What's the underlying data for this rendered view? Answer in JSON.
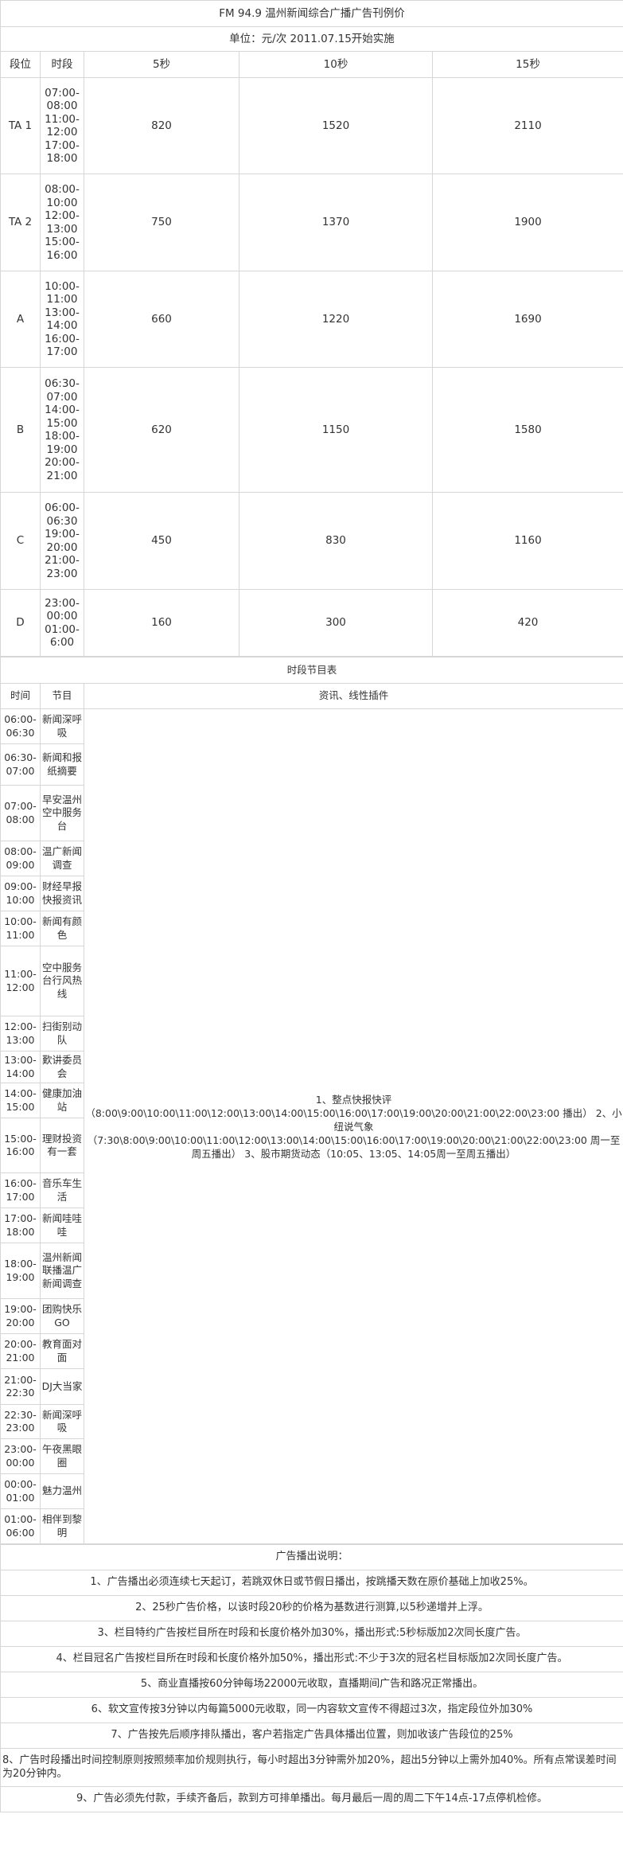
{
  "title": "FM 94.9 温州新闻综合广播广告刊例价",
  "subtitle": "单位：元/次  2011.07.15开始实施",
  "rate_headers": [
    "段位",
    "时段",
    "5秒",
    "10秒",
    "15秒"
  ],
  "rate_rows": [
    {
      "tier": "TA 1",
      "slots": "07:00-\n08:00\n11:00-\n12:00\n17:00-\n18:00",
      "p5": "820",
      "p10": "1520",
      "p15": "2110"
    },
    {
      "tier": "TA 2",
      "slots": "08:00-\n10:00\n12:00-\n13:00\n15:00-\n16:00",
      "p5": "750",
      "p10": "1370",
      "p15": "1900"
    },
    {
      "tier": "A",
      "slots": "10:00-\n11:00\n13:00-\n14:00\n16:00-\n17:00",
      "p5": "660",
      "p10": "1220",
      "p15": "1690"
    },
    {
      "tier": "B",
      "slots": "06:30-\n07:00\n14:00-\n15:00\n18:00-\n19:00\n20:00-\n21:00",
      "p5": "620",
      "p10": "1150",
      "p15": "1580"
    },
    {
      "tier": "C",
      "slots": "06:00-\n06:30\n19:00-\n20:00\n21:00-\n23:00",
      "p5": "450",
      "p10": "830",
      "p15": "1160"
    },
    {
      "tier": "D",
      "slots": "23:00-\n00:00\n01:00-\n6:00",
      "p5": "160",
      "p10": "300",
      "p15": "420"
    }
  ],
  "schedule_title": "时段节目表",
  "schedule_headers": [
    "时间",
    "节目",
    "资讯、线性插件"
  ],
  "schedule_info": "1、整点快报快评\n（8:00\\9:00\\10:00\\11:00\\12:00\\13:00\\14:00\\15:00\\16:00\\17:00\\19:00\\20:00\\21:00\\22:00\\23:00  播出） 2、小纽说气象\n（7:30\\8:00\\9:00\\10:00\\11:00\\12:00\\13:00\\14:00\\15:00\\16:00\\17:00\\19:00\\20:00\\21:00\\22:00\\23:00 周一至周五播出） 3、股市期货动态（10:05、13:05、14:05周一至周五播出）",
  "schedule_rows": [
    {
      "time": "06:00-\n06:30",
      "program": "新闻深呼吸"
    },
    {
      "time": "06:30-\n07:00",
      "program": "新闻和报纸摘要"
    },
    {
      "time": "07:00-\n08:00",
      "program": "早安温州 空中服务台"
    },
    {
      "time": "08:00-\n09:00",
      "program": "温广新闻调查"
    },
    {
      "time": "09:00-\n10:00",
      "program": "财经早报 快报资讯"
    },
    {
      "time": "10:00-\n11:00",
      "program": "新闻有颜色"
    },
    {
      "time": "11:00-\n12:00",
      "program": "空中服务台行风热线"
    },
    {
      "time": "12:00-\n13:00",
      "program": "扫街别动队"
    },
    {
      "time": "13:00-\n14:00",
      "program": "歎讲委员会"
    },
    {
      "time": "14:00-\n15:00",
      "program": "健康加油站"
    },
    {
      "time": "15:00-\n16:00",
      "program": "理财投资有一套"
    },
    {
      "time": "16:00-\n17:00",
      "program": "音乐车生活"
    },
    {
      "time": "17:00-\n18:00",
      "program": "新闻哇哇哇"
    },
    {
      "time": "18:00-\n19:00",
      "program": "温州新闻联播温广新闻调查"
    },
    {
      "time": "19:00-\n20:00",
      "program": "团购快乐GO"
    },
    {
      "time": "20:00-\n21:00",
      "program": "教育面对面"
    },
    {
      "time": "21:00-\n22:30",
      "program": "DJ大当家"
    },
    {
      "time": "22:30-\n23:00",
      "program": "新闻深呼吸"
    },
    {
      "time": "23:00-\n00:00",
      "program": "午夜黑眼圈"
    },
    {
      "time": "00:00-\n01:00",
      "program": "魅力温州"
    },
    {
      "time": "01:00-\n06:00",
      "program": "相伴到黎明"
    }
  ],
  "notes_title": "广告播出说明：",
  "notes": [
    "1、广告播出必须连续七天起订，若跳双休日或节假日播出，按跳播天数在原价基础上加收25%。",
    "2、25秒广告价格，以该时段20秒的价格为基数进行测算,以5秒递增并上浮。",
    "3、栏目特约广告按栏目所在时段和长度价格外加30%，播出形式:5秒标版加2次同长度广告。",
    "4、栏目冠名广告按栏目所在时段和长度价格外加50%，播出形式:不少于3次的冠名栏目标版加2次同长度广告。",
    "5、商业直播按60分钟每场22000元收取，直播期间广告和路况正常播出。",
    "6、软文宣传按3分钟以内每篇5000元收取，同一内容软文宣传不得超过3次，指定段位外加30%",
    "7、广告按先后顺序排队播出，客户若指定广告具体播出位置，则加收该广告段位的25%",
    "8、广告时段播出时间控制原则按照频率加价规则执行，每小时超出3分钟需外加20%，超出5分钟以上需外加40%。所有点常误差时间为20分钟内。",
    "9、广告必须先付款，手续齐备后，款到方可排单播出。每月最后一周的周二下午14点-17点停机检修。"
  ]
}
